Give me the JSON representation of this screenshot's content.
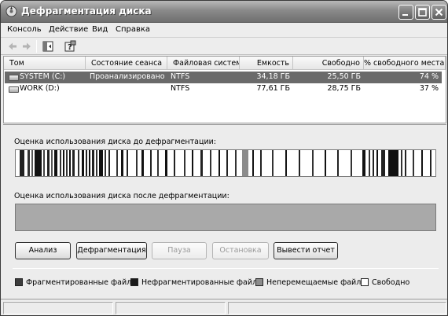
{
  "window": {
    "title": "Дефрагментация диска"
  },
  "menu": [
    "Консоль",
    "Действие",
    "Вид",
    "Справка"
  ],
  "volumes": {
    "columns": [
      "Том",
      "Состояние сеанса",
      "Файловая система",
      "Емкость",
      "Свободно",
      "% свободного места"
    ],
    "rows": [
      {
        "name": "SYSTEM (C:)",
        "status": "Проанализировано",
        "fs": "NTFS",
        "capacity": "34,18 ГБ",
        "free": "25,50 ГБ",
        "free_pct": "74 %",
        "selected": true
      },
      {
        "name": "WORK (D:)",
        "status": "",
        "fs": "NTFS",
        "capacity": "77,61 ГБ",
        "free": "28,75 ГБ",
        "free_pct": "37 %",
        "selected": false
      }
    ]
  },
  "analysis": {
    "before_label": "Оценка использования диска до дефрагментации:",
    "after_label": "Оценка использования диска после дефрагментации:"
  },
  "buttons": {
    "analyze": "Анализ",
    "defragment": "Дефрагментация",
    "pause": "Пауза",
    "stop": "Остановка",
    "report": "Вывести отчет"
  },
  "legend": {
    "fragmented": "Фрагментированные файлы",
    "contiguous": "Нефрагментированные файлы",
    "unmovable": "Неперемещаемые файлы",
    "free": "Свободно"
  },
  "colors": {
    "fragmented": "#3c3c3c",
    "contiguous": "#1a1a1a",
    "unmovable": "#8c8c8c",
    "free": "#ffffff",
    "selection": "#6a6a6a"
  }
}
